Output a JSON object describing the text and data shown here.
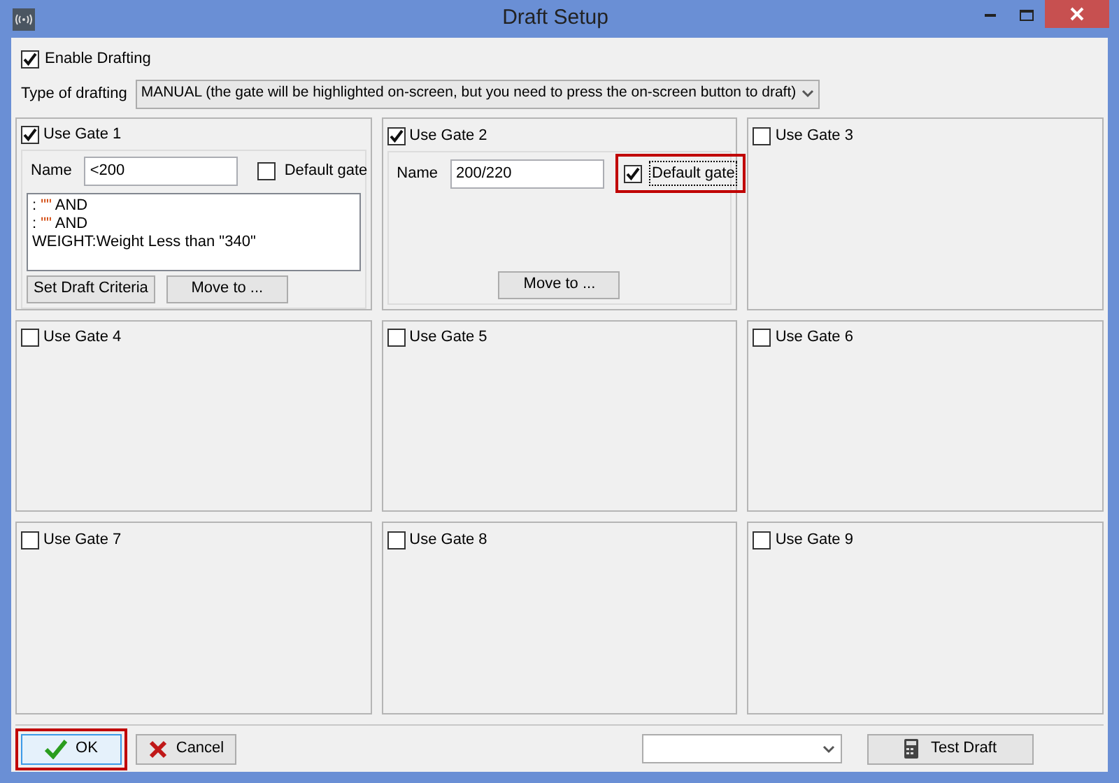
{
  "window": {
    "title": "Draft Setup"
  },
  "enable_drafting": {
    "label": "Enable Drafting",
    "checked": true
  },
  "type_of_drafting": {
    "label": "Type of drafting",
    "value": "MANUAL (the gate will be highlighted on-screen, but you need to press the on-screen button to draft)"
  },
  "gates": [
    {
      "label": "Use Gate 1",
      "checked": true,
      "name_label": "Name",
      "name": "<200",
      "default_gate": {
        "label": "Default gate",
        "checked": false,
        "highlighted": false
      },
      "criteria": [
        {
          "kind": "quoted",
          "prefix": ":",
          "quote": "\"\"",
          "suffix": "AND"
        },
        {
          "kind": "quoted",
          "prefix": ":",
          "quote": "\"\"",
          "suffix": "AND"
        },
        {
          "kind": "plain",
          "text": "WEIGHT:Weight Less than \"340\""
        }
      ],
      "set_criteria": "Set Draft Criteria",
      "move_to": "Move to ..."
    },
    {
      "label": "Use Gate 2",
      "checked": true,
      "name_label": "Name",
      "name": "200/220",
      "default_gate": {
        "label": "Default gate",
        "checked": true,
        "highlighted": true
      },
      "move_to": "Move to ..."
    },
    {
      "label": "Use Gate 3",
      "checked": false
    },
    {
      "label": "Use Gate 4",
      "checked": false
    },
    {
      "label": "Use Gate 5",
      "checked": false
    },
    {
      "label": "Use Gate 6",
      "checked": false
    },
    {
      "label": "Use Gate 7",
      "checked": false
    },
    {
      "label": "Use Gate 8",
      "checked": false
    },
    {
      "label": "Use Gate 9",
      "checked": false
    }
  ],
  "footer": {
    "ok": {
      "label": "OK",
      "highlighted": true
    },
    "cancel": {
      "label": "Cancel"
    },
    "test_draft": {
      "label": "Test Draft"
    }
  }
}
